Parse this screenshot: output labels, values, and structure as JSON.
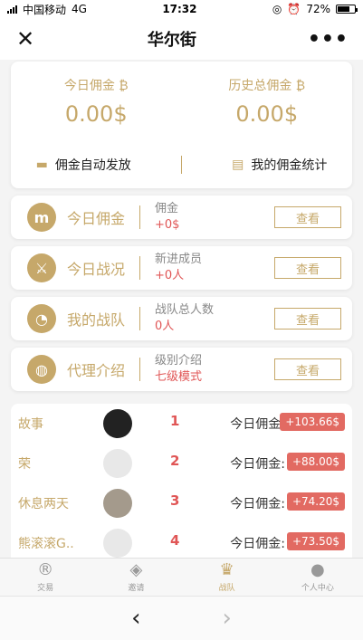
{
  "status": {
    "carrier": "中国移动",
    "network": "4G",
    "time": "17:32",
    "battery": "72%",
    "battery_level": 0.72
  },
  "header": {
    "title": "华尔街",
    "close_icon": "close-icon",
    "more_icon": "more-icon"
  },
  "summary": {
    "today_label": "今日佣金",
    "today_value": "0.00$",
    "total_label": "历史总佣金",
    "total_value": "0.00$",
    "currency_icon": "bitcoin-icon",
    "auto_payout": "佣金自动发放",
    "stats": "我的佣金统计"
  },
  "menu": [
    {
      "title": "今日佣金",
      "icon": "commission-icon",
      "info_key": "佣金",
      "info_value": "+0$",
      "button": "查看"
    },
    {
      "title": "今日战况",
      "icon": "battle-icon",
      "info_key": "新进成员",
      "info_value": "+0人",
      "button": "查看"
    },
    {
      "title": "我的战队",
      "icon": "pie-chart-icon",
      "info_key": "战队总人数",
      "info_value": "0人",
      "button": "查看"
    },
    {
      "title": "代理介绍",
      "icon": "globe-icon",
      "info_key": "级别介绍",
      "info_value": "七级模式",
      "button": "查看"
    }
  ],
  "ranking": [
    {
      "name": "故事",
      "rank": "1",
      "label": "今日佣金:",
      "amount": "+103.66$"
    },
    {
      "name": "荣",
      "rank": "2",
      "label": "今日佣金:",
      "amount": "+88.00$"
    },
    {
      "name": "休息两天",
      "rank": "3",
      "label": "今日佣金:",
      "amount": "+74.20$"
    },
    {
      "name": "熊滚滚G..",
      "rank": "4",
      "label": "今日佣金:",
      "amount": "+73.50$"
    }
  ],
  "tabs": [
    {
      "label": "交易",
      "icon": "registered-icon"
    },
    {
      "label": "邀请",
      "icon": "invite-icon"
    },
    {
      "label": "战队",
      "icon": "trophy-icon"
    },
    {
      "label": "个人中心",
      "icon": "user-icon"
    }
  ],
  "colors": {
    "accent": "#c6a86a",
    "danger": "#e05656"
  }
}
